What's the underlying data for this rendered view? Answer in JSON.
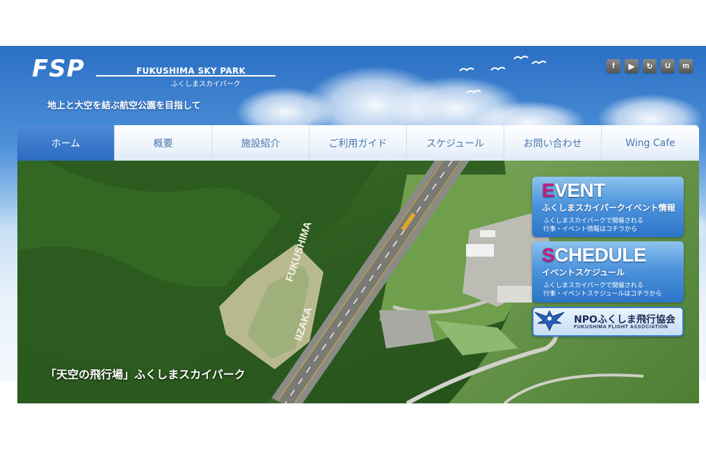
{
  "header": {
    "logo_mark": "FSP",
    "logo_en": "FUKUSHIMA SKY PARK",
    "logo_jp": "ふくしまスカイパーク",
    "tagline": "地上と大空を結ぶ航空公園を目指して"
  },
  "social": [
    {
      "icon": "facebook-icon",
      "glyph": "f"
    },
    {
      "icon": "youtube-icon",
      "glyph": "▶"
    },
    {
      "icon": "share-icon",
      "glyph": "↻"
    },
    {
      "icon": "ustream-icon",
      "glyph": "U"
    },
    {
      "icon": "mixi-icon",
      "glyph": "m"
    }
  ],
  "nav": {
    "items": [
      {
        "label": "ホーム",
        "active": true
      },
      {
        "label": "概要"
      },
      {
        "label": "施設紹介"
      },
      {
        "label": "ご利用ガイド"
      },
      {
        "label": "スケジュール"
      },
      {
        "label": "お問い合わせ"
      },
      {
        "label": "Wing Cafe"
      }
    ]
  },
  "hero": {
    "caption": "「天空の飛行場」ふくしまスカイパーク",
    "ground_text_1": "FUKUSHIMA",
    "ground_text_2": "IIZAKA"
  },
  "banners": {
    "event": {
      "big_first": "E",
      "big_rest": "VENT",
      "sub": "ふくしまスカイパークイベント情報",
      "desc_1": "ふくしまスカイパークで開催される",
      "desc_2": "行事・イベント情報はコチラから"
    },
    "schedule": {
      "big_first": "S",
      "big_rest": "CHEDULE",
      "sub": "イベントスケジュール",
      "desc_1": "ふくしまスカイパークで開催される",
      "desc_2": "行事・イベントスケジュールはコチラから"
    },
    "npo": {
      "title": "NPOふくしま飛行協会",
      "sub": "FUKUSHIMA FLIGHT ASSOCIATION"
    }
  }
}
